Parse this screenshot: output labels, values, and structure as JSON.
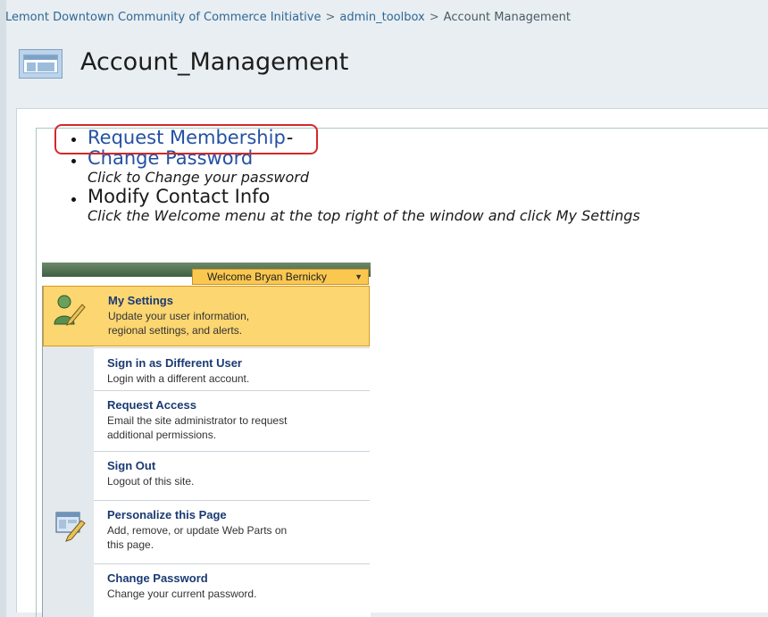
{
  "breadcrumb": {
    "site": "Lemont Downtown Community of Commerce Initiative",
    "separator": ">",
    "toolbox": "admin_toolbox",
    "current": "Account Management"
  },
  "page": {
    "title": "Account_Management"
  },
  "links": [
    {
      "label": "Request Membership",
      "suffix": "-",
      "description": ""
    },
    {
      "label": "Change Password",
      "description": "Click to Change your password"
    },
    {
      "label": "Modify Contact Info",
      "description": "Click the Welcome menu at the top right of the window and click My Settings"
    }
  ],
  "menu": {
    "welcome": "Welcome Bryan Bernicky",
    "items": [
      {
        "title": "My Settings",
        "desc1": "Update your user information,",
        "desc2": "regional settings, and alerts."
      },
      {
        "title": "Sign in as Different User",
        "desc1": "Login with a different account.",
        "desc2": ""
      },
      {
        "title": "Request Access",
        "desc1": "Email the site administrator to request",
        "desc2": "additional permissions."
      },
      {
        "title": "Sign Out",
        "desc1": "Logout of this site.",
        "desc2": ""
      },
      {
        "title": "Personalize this Page",
        "desc1": "Add, remove, or update Web Parts on",
        "desc2": "this page."
      },
      {
        "title": "Change Password",
        "desc1": "Change your current password.",
        "desc2": ""
      }
    ]
  },
  "colors": {
    "highlight": "#d4282a",
    "link": "#2451a3",
    "menu_active": "#fbd671"
  }
}
